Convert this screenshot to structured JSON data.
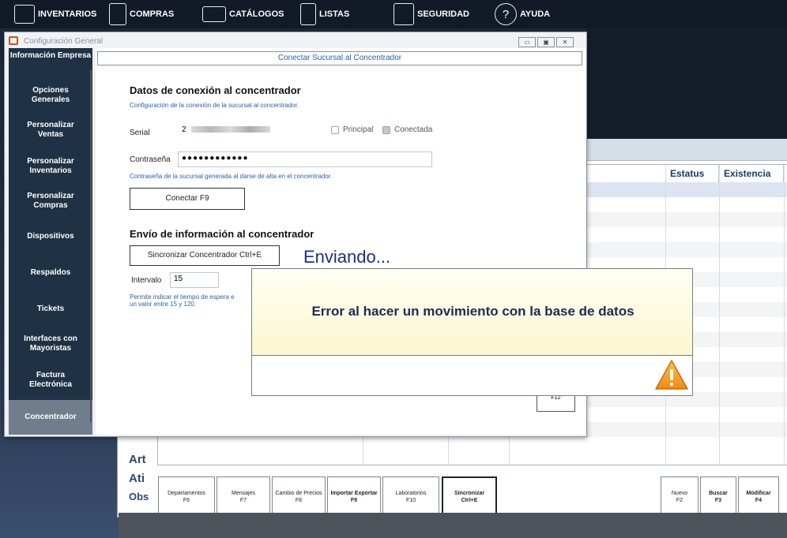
{
  "nav": {
    "items": [
      {
        "label": "INVENTARIOS",
        "icon": "inventory-icon"
      },
      {
        "label": "COMPRAS",
        "icon": "purchases-icon"
      },
      {
        "label": "CATÁLOGOS",
        "icon": "folder-icon"
      },
      {
        "label": "LISTAS",
        "icon": "list-icon"
      },
      {
        "label": "SEGURIDAD",
        "icon": "security-icon"
      },
      {
        "label": "AYUDA",
        "icon": "help-icon",
        "glyph": "?"
      }
    ]
  },
  "background_window": {
    "grid_headers": [
      "Estatus",
      "Existencia"
    ],
    "side_labels": [
      "Art",
      "Ati",
      "Obs"
    ],
    "bottom_buttons": [
      {
        "label": "Departamentos",
        "key": "F6"
      },
      {
        "label": "Mensajes",
        "key": "F7"
      },
      {
        "label": "Cambio de Precios",
        "key": "F8"
      },
      {
        "label": "Importar Exportar",
        "key": "F9"
      },
      {
        "label": "Laboratorios",
        "key": "F10"
      },
      {
        "label": "Sincronizar",
        "key": "Ctrl+E"
      },
      {
        "label": "Nuevo",
        "key": "F2"
      },
      {
        "label": "Buscar",
        "key": "F3"
      },
      {
        "label": "Modificar",
        "key": "F4"
      }
    ],
    "f12_label": "F12"
  },
  "config_window": {
    "title": "Configuración General",
    "sidebar": [
      {
        "label": "Información Empresa"
      },
      {
        "label": "Opciones Generales"
      },
      {
        "label": "Personalizar Ventas"
      },
      {
        "label": "Personalizar Inventarios"
      },
      {
        "label": "Personalizar Compras"
      },
      {
        "label": "Dispositivos"
      },
      {
        "label": "Respaldos"
      },
      {
        "label": "Tickets"
      },
      {
        "label": "Interfaces con Mayoristas"
      },
      {
        "label": "Factura Electrónica"
      },
      {
        "label": "Concentrador",
        "active": true
      }
    ],
    "header": "Conectar Sucursal al Concentrador",
    "connection": {
      "title": "Datos de conexión al concentrador",
      "subtitle": "Configuración de la conexión de la sucursal al concentrador.",
      "serial_label": "Serial",
      "serial_value": "2",
      "principal_label": "Principal",
      "conectada_label": "Conectada",
      "password_label": "Contraseña",
      "password_value": "●●●●●●●●●●●●",
      "password_hint": "Contraseña de la sucursal generada al darse de alta en el concentrador.",
      "connect_button": "Conectar F9"
    },
    "sending": {
      "title": "Envío de información al concentrador",
      "sync_button": "Sincronizar Concentrador Ctrl+E",
      "interval_label": "Intervalo",
      "interval_value": "15",
      "interval_hint_1": "Permite indicar el tiempo de espera e",
      "interval_hint_2": "un valor entre 15 y 120."
    },
    "status_text": "Enviando..."
  },
  "error_popup": {
    "message": "Error al hacer un movimiento con la base de datos",
    "icon": "warning-icon",
    "accent": "#f7a51c"
  }
}
